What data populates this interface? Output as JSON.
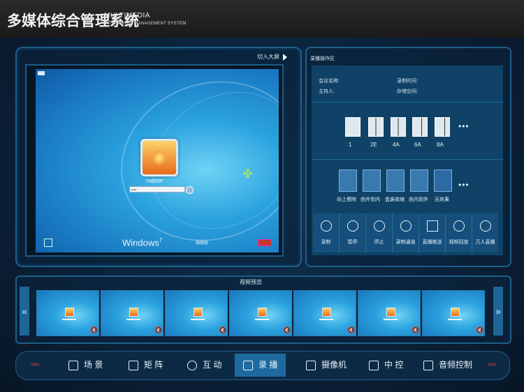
{
  "header": {
    "title_cn": "多媒体综合管理系统",
    "title_en_1": "MULTIMEDIA",
    "title_en_2": "INTEGRATED MANAGEMENT SYSTEM"
  },
  "screen": {
    "fullscreen_label": "切入大屏",
    "username": "YWERP",
    "password_hint": "pwd",
    "windows_text": "Windows",
    "windows_version": "7",
    "windows_edition": "旗舰版"
  },
  "recorder": {
    "title": "录播操作区",
    "meeting_name_label": "会议名称:",
    "host_label": "主持人:",
    "record_time_label": "录制时间:",
    "storage_label": "存储空间:",
    "layouts": [
      "1",
      "2E",
      "4A",
      "6A",
      "8A"
    ],
    "effects": [
      "向上擦除",
      "由外到内",
      "盒装收缩",
      "由内到外",
      "无效果"
    ],
    "more": "•••",
    "controls": [
      "录制",
      "暂停",
      "停止",
      "录制通道",
      "直播推送",
      "视频回放",
      "万人直播"
    ]
  },
  "preview": {
    "title": "视频预览",
    "prev": "«",
    "next": "»",
    "thumb_count": 7
  },
  "nav": {
    "items": [
      "场 景",
      "矩 阵",
      "互 动",
      "录 播",
      "摄像机",
      "中 控",
      "音频控制"
    ],
    "active_index": 3,
    "left_deco": "‹‹‹‹‹",
    "right_deco": "›››››"
  }
}
